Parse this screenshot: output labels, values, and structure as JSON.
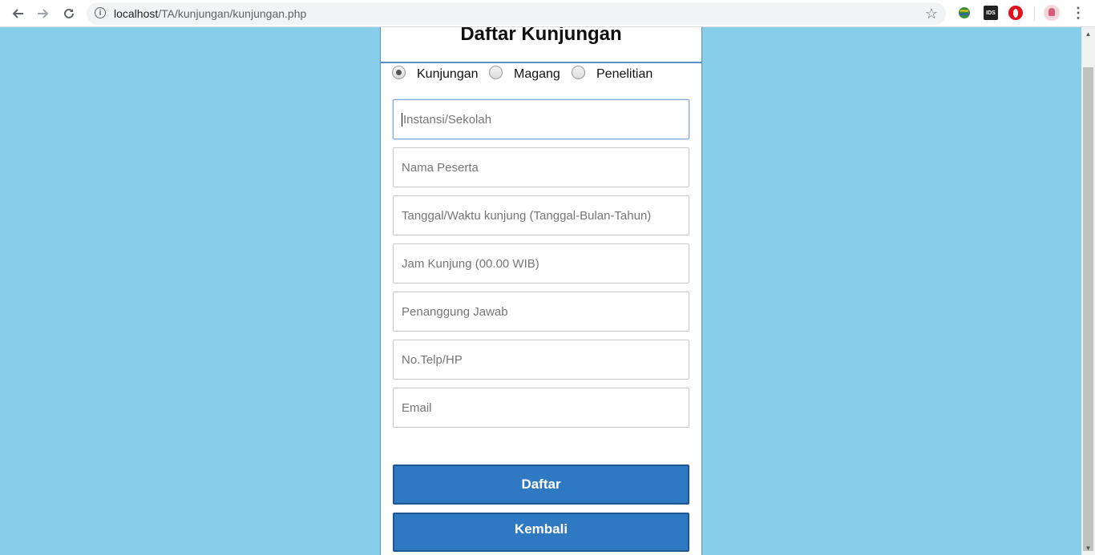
{
  "browser": {
    "url_host": "localhost",
    "url_path": "/TA/kunjungan/kunjungan.php"
  },
  "form": {
    "title": "Daftar Kunjungan",
    "radios": [
      {
        "label": "Kunjungan",
        "checked": true
      },
      {
        "label": "Magang",
        "checked": false
      },
      {
        "label": "Penelitian",
        "checked": false
      }
    ],
    "fields": [
      {
        "placeholder": "Instansi/Sekolah",
        "value": "",
        "focused": true
      },
      {
        "placeholder": "Nama Peserta",
        "value": ""
      },
      {
        "placeholder": "Tanggal/Waktu kunjung (Tanggal-Bulan-Tahun)",
        "value": ""
      },
      {
        "placeholder": "Jam Kunjung (00.00 WIB)",
        "value": ""
      },
      {
        "placeholder": "Penanggung Jawab",
        "value": ""
      },
      {
        "placeholder": "No.Telp/HP",
        "value": ""
      },
      {
        "placeholder": "Email",
        "value": ""
      }
    ],
    "submit_label": "Daftar",
    "back_label": "Kembali"
  },
  "colors": {
    "page_background": "#87ceeb",
    "button": "#2f78c2",
    "panel_border": "#5a8fc4"
  },
  "icons": [
    "back-arrow-icon",
    "forward-arrow-icon",
    "reload-icon",
    "info-icon",
    "star-icon",
    "globe-extension-icon",
    "ids-extension-icon",
    "opera-icon",
    "avatar",
    "menu-icon"
  ]
}
